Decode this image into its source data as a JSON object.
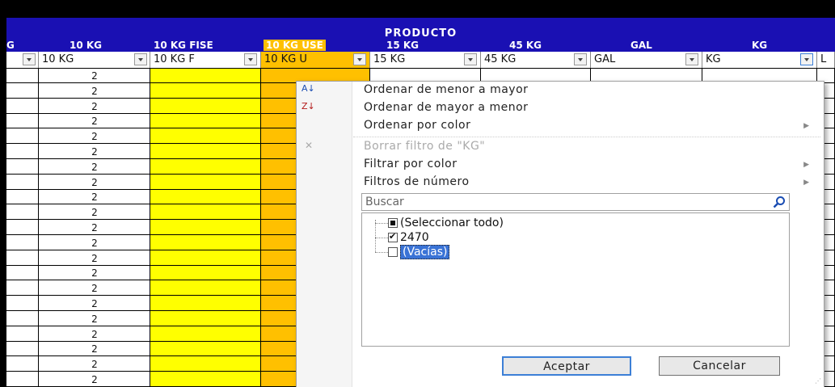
{
  "header": {
    "group_title": "PRODUCTO",
    "columns": [
      "G",
      "10 KG",
      "10 KG FISE",
      "10 KG USE",
      "15 KG",
      "45 KG",
      "GAL",
      "KG"
    ]
  },
  "filter_row": [
    "",
    "10 KG",
    "10 KG F",
    "10 KG U",
    "15 KG",
    "45 KG",
    "GAL",
    "KG",
    "L"
  ],
  "grid": {
    "col_10kg_value": "2",
    "row_count": 21
  },
  "menu": {
    "sort_asc": "Ordenar de menor a mayor",
    "sort_desc": "Ordenar de mayor a menor",
    "sort_color": "Ordenar por color",
    "clear_filter": "Borrar filtro de \"KG\"",
    "filter_color": "Filtrar por color",
    "number_filters": "Filtros de número",
    "search_placeholder": "Buscar",
    "items": [
      {
        "label": "(Seleccionar todo)",
        "state": "partial"
      },
      {
        "label": "2470",
        "state": "checked"
      },
      {
        "label": "(Vacías)",
        "state": "unchecked"
      }
    ],
    "ok": "Aceptar",
    "cancel": "Cancelar"
  },
  "colors": {
    "header_blue": "#1a10b3",
    "yellow": "#ffff00",
    "orange": "#ffc000",
    "selection": "#3a73d6"
  }
}
